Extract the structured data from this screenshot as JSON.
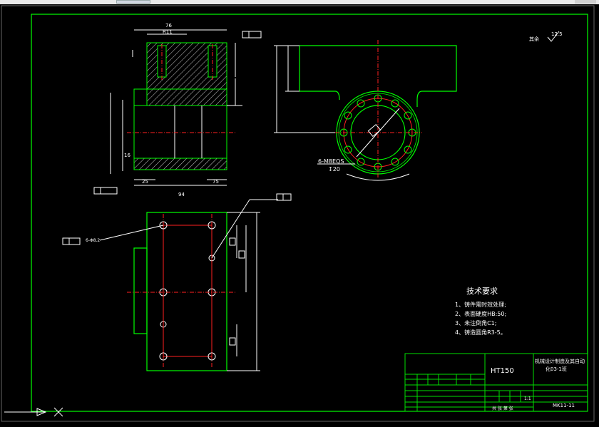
{
  "drawing": {
    "material": "HT150",
    "title_line1": "机械设计制造及其自动",
    "title_line2": "化03-1班",
    "part_no": "MK11-11",
    "scale": "1:1",
    "sheet_label": "共 张 第 张",
    "surface_note": "其余",
    "surface_value": "12.5",
    "tech_title": "技术要求",
    "tech_items": [
      "1、铸件需时效处理;",
      "2、表面硬度HB:50;",
      "3、未注倒角C1;",
      "4、铸造圆角R3-5。"
    ],
    "hole_callout": "6-M8EQS",
    "hole_depth": "↧20",
    "hole_callout_2": "6-Φ8.2",
    "dim_94": "94",
    "dim_25": "25",
    "dim_75": "75",
    "dim_16": "16"
  },
  "colors": {
    "frame": "#00ff00",
    "line": "#ffffff",
    "center": "#ff2020",
    "title_block": "#00e000"
  }
}
